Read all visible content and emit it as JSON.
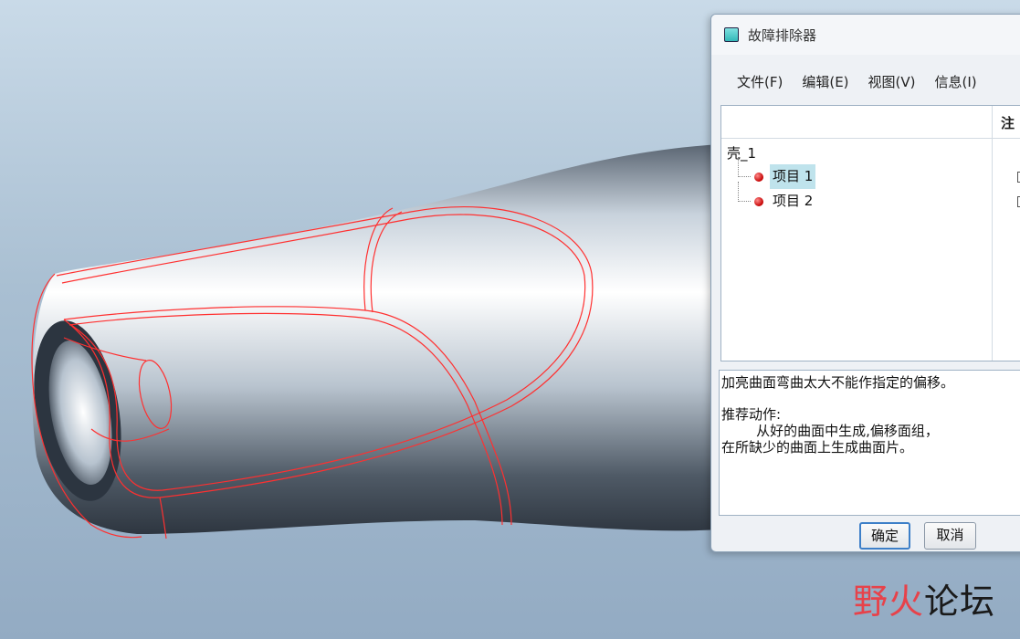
{
  "dialog": {
    "title": "故障排除器",
    "menus": [
      "文件(F)",
      "编辑(E)",
      "视图(V)",
      "信息(I)"
    ],
    "column_note": "注",
    "tree": {
      "root": "壳_1",
      "items": [
        {
          "label": "项目 1",
          "selected": true
        },
        {
          "label": "项目 2",
          "selected": false
        }
      ]
    },
    "message": {
      "line1": "加亮曲面弯曲太大不能作指定的偏移。",
      "recommend_label": "推荐动作:",
      "line2": "        从好的曲面中生成,偏移面组，",
      "line3": "在所缺少的曲面上生成曲面片。"
    },
    "ok_label": "确定",
    "cancel_label": "取消"
  },
  "watermark": {
    "part1": "野火",
    "part2": "论坛"
  },
  "colors": {
    "highlight": "#bfe3ec",
    "edge_red": "#ff3030",
    "watermark_red": "#e7424a"
  }
}
